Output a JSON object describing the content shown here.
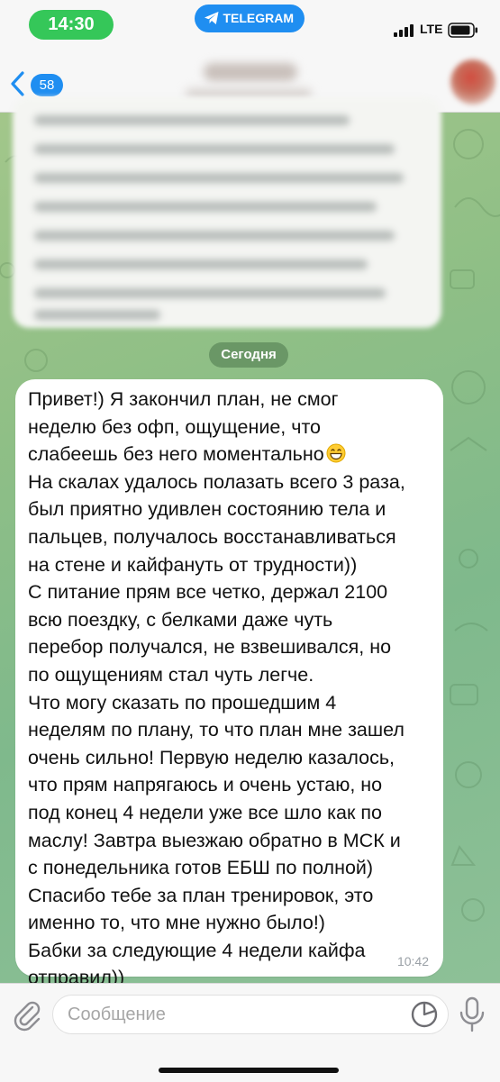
{
  "status_bar": {
    "time": "14:30",
    "app_label": "TELEGRAM",
    "network": "LTE"
  },
  "header": {
    "back_count": "58"
  },
  "chat": {
    "date_label": "Сегодня",
    "message": {
      "lines": [
        "Привет!) Я закончил план, не смог",
        "неделю без офп, ощущение, что",
        "слабеешь без него моментально",
        "На скалах удалось полазать всего 3 раза,",
        "был приятно удивлен состоянию тела и",
        "пальцев, получалось восстанавливаться",
        "на стене и кайфануть от трудности))",
        "С питание прям все четко, держал 2100",
        "всю поездку, с белками даже чуть",
        "перебор получался, не взвешивался, но",
        "по ощущениям стал чуть легче.",
        "Что могу сказать по прошедшим 4",
        "неделям по плану, то что план мне зашел",
        "очень сильно! Первую неделю казалось,",
        "что прям напрягаюсь и очень устаю, но",
        "под конец 4 недели уже все шло как по",
        "маслу! Завтра выезжаю обратно в МСК и",
        "с понедельника готов ЕБШ по полной)",
        "Спасибо тебе за план тренировок, это",
        "именно то, что мне нужно было!)",
        "Бабки за следующие 4 недели кайфа",
        "отправил))"
      ],
      "emoji": "grinning-face-emoji",
      "time": "10:42"
    }
  },
  "input_bar": {
    "placeholder": "Сообщение"
  },
  "colors": {
    "accent": "#1f8ef1",
    "time_pill": "#35c759",
    "bubble": "#ffffff",
    "date_pill": "#588557"
  }
}
